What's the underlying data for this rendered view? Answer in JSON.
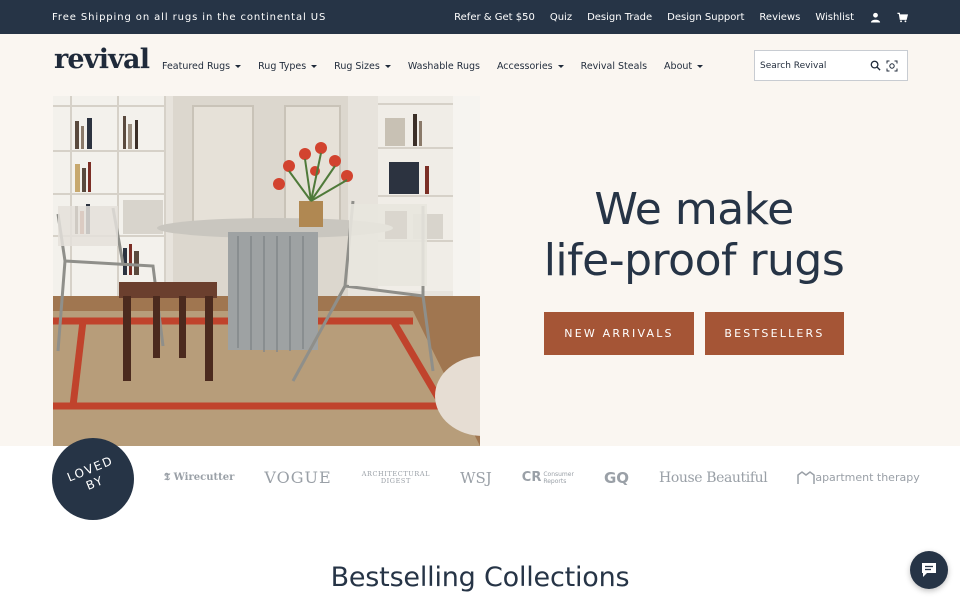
{
  "topbar": {
    "promo": "Free Shipping on all rugs in the continental US",
    "links": [
      "Refer & Get $50",
      "Quiz",
      "Design Trade",
      "Design Support",
      "Reviews",
      "Wishlist"
    ],
    "icons": [
      "account-icon",
      "cart-icon"
    ]
  },
  "header": {
    "logo": "revival",
    "nav": [
      {
        "label": "Featured Rugs",
        "dropdown": true
      },
      {
        "label": "Rug Types",
        "dropdown": true
      },
      {
        "label": "Rug Sizes",
        "dropdown": true
      },
      {
        "label": "Washable Rugs",
        "dropdown": false
      },
      {
        "label": "Accessories",
        "dropdown": true
      },
      {
        "label": "Revival Steals",
        "dropdown": false
      },
      {
        "label": "About",
        "dropdown": true
      }
    ],
    "search": {
      "placeholder": "Search Revival",
      "icons": [
        "search-icon",
        "visual-search-icon"
      ]
    }
  },
  "hero": {
    "title_line1": "We make",
    "title_line2": "life-proof rugs",
    "buttons": [
      "NEW ARRIVALS",
      "BESTSELLERS"
    ],
    "image": "dining room with round pedestal table, chairs and red-patterned rug"
  },
  "press": {
    "badge_line1": "LOVED",
    "badge_line2": "BY",
    "logos": [
      "Wirecutter",
      "VOGUE",
      "ARCHITECTURAL DIGEST",
      "WSJ",
      "Consumer Reports",
      "GQ",
      "House Beautiful",
      "apartment therapy"
    ]
  },
  "section": {
    "title": "Bestselling Collections"
  },
  "colors": {
    "navy": "#263446",
    "accent": "#a55536",
    "cream": "#faf6f1",
    "muted": "#9aa0a7"
  }
}
